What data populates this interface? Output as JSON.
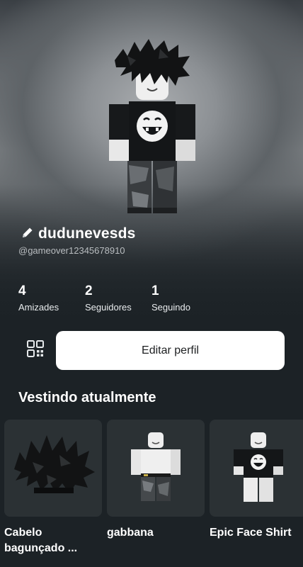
{
  "profile": {
    "display_name": "dudunevesds",
    "handle": "@gameover12345678910"
  },
  "stats": [
    {
      "value": "4",
      "label": "Amizades"
    },
    {
      "value": "2",
      "label": "Seguidores"
    },
    {
      "value": "1",
      "label": "Seguindo"
    }
  ],
  "actions": {
    "edit_profile": "Editar perfil"
  },
  "wearing": {
    "title": "Vestindo atualmente",
    "items": [
      {
        "name": "Cabelo bagunçado ..."
      },
      {
        "name": "gabbana"
      },
      {
        "name": "Epic Face Shirt"
      }
    ]
  },
  "icons": {
    "edit": "pencil-icon",
    "qr": "qr-code-icon"
  },
  "colors": {
    "background": "#1c2226",
    "button": "#ffffff",
    "card": "#2b3134"
  }
}
